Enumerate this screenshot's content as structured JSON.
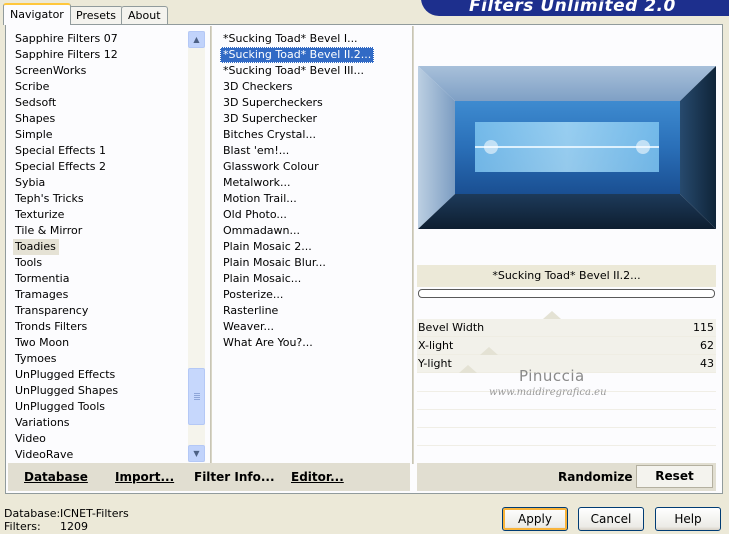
{
  "logo": {
    "text": "Filters Unlimited 2.0"
  },
  "tabs": [
    {
      "label": "Navigator",
      "active": true
    },
    {
      "label": "Presets",
      "active": false
    },
    {
      "label": "About",
      "active": false
    }
  ],
  "categories": {
    "items": [
      "Sapphire Filters 07",
      "Sapphire Filters 12",
      "ScreenWorks",
      "Scribe",
      "Sedsoft",
      "Shapes",
      "Simple",
      "Special Effects 1",
      "Special Effects 2",
      "Sybia",
      "Teph's Tricks",
      "Texturize",
      "Tile & Mirror",
      "Toadies",
      "Tools",
      "Tormentia",
      "Tramages",
      "Transparency",
      "Tronds Filters",
      "Two Moon",
      "Tymoes",
      "UnPlugged Effects",
      "UnPlugged Shapes",
      "UnPlugged Tools",
      "Variations",
      "Video",
      "VideoRave"
    ],
    "selected": "Toadies"
  },
  "filters": {
    "items": [
      "*Sucking Toad*  Bevel I...",
      "*Sucking Toad*  Bevel II.2...",
      "*Sucking Toad*  Bevel III...",
      "3D Checkers",
      "3D Supercheckers",
      "3D Superchecker",
      "Bitches Crystal...",
      "Blast 'em!...",
      "Glasswork Colour",
      "Metalwork...",
      "Motion Trail...",
      "Old Photo...",
      "Ommadawn...",
      "Plain Mosaic 2...",
      "Plain Mosaic Blur...",
      "Plain Mosaic...",
      "Posterize...",
      "Rasterline",
      "Weaver...",
      "What Are You?..."
    ],
    "selected": "*Sucking Toad*  Bevel II.2..."
  },
  "preview": {
    "filter_name": "*Sucking Toad*  Bevel II.2..."
  },
  "params": [
    {
      "label": "Bevel Width",
      "value": "115"
    },
    {
      "label": "X-light",
      "value": "62"
    },
    {
      "label": "Y-light",
      "value": "43"
    }
  ],
  "watermark": {
    "line1": "Pinuccia",
    "line2": "www.maidiregrafica.eu"
  },
  "bottom_bar": {
    "database": "Database",
    "import": "Import...",
    "filter_info": "Filter Info...",
    "editor": "Editor...",
    "randomize": "Randomize",
    "reset": "Reset"
  },
  "status": {
    "database_label": "Database:",
    "database_value": "ICNET-Filters",
    "filters_label": "Filters:",
    "filters_value": "1209"
  },
  "dialog": {
    "apply": "Apply",
    "cancel": "Cancel",
    "help": "Help"
  },
  "colors": {
    "selection": "#316AC5",
    "window_bg": "#ECE9D8",
    "logo_bg": "#1D2F8D",
    "focus_ring": "#F8B33A"
  }
}
